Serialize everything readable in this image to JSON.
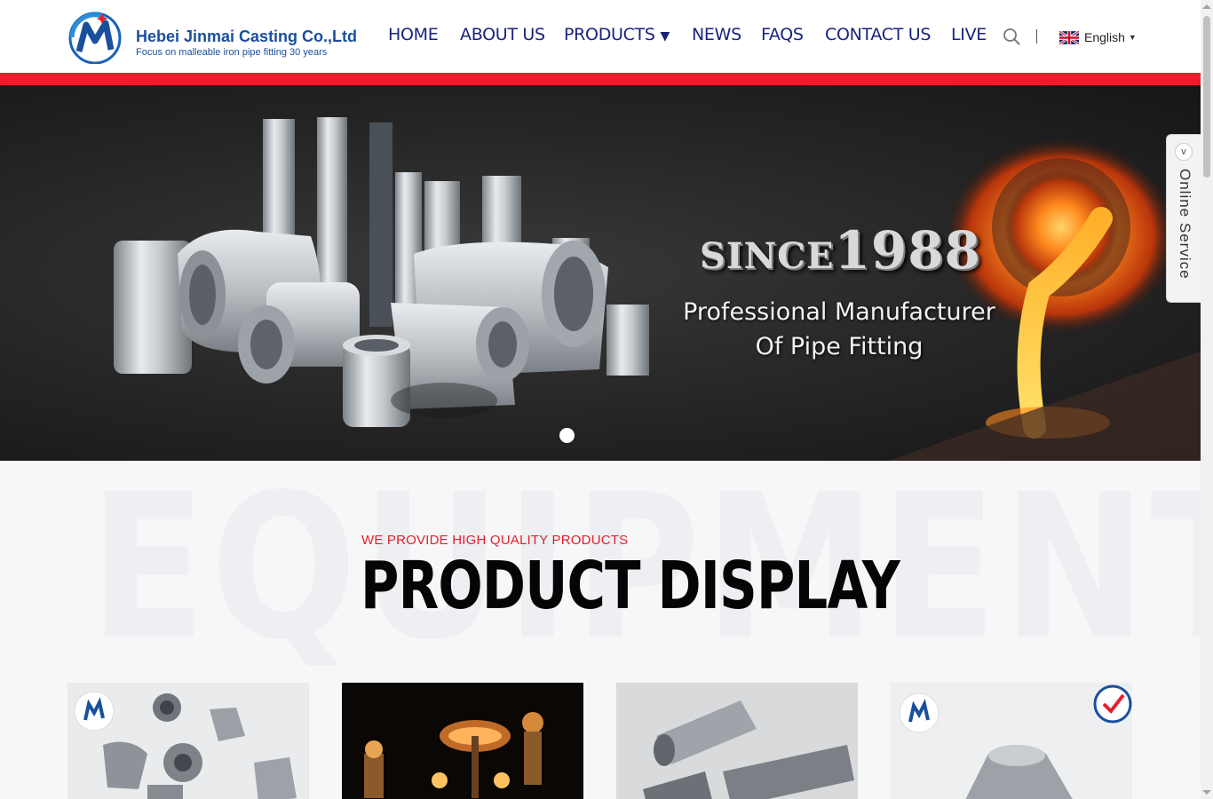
{
  "header": {
    "brand_name": "Hebei Jinmai Casting Co.,Ltd",
    "brand_tagline": "Focus on malleable iron pipe fitting 30 years",
    "nav": [
      "HOME",
      "ABOUT US",
      "PRODUCTS",
      "NEWS",
      "FAQS",
      "CONTACT US",
      "LIVE"
    ],
    "language": "English",
    "colors": {
      "brand_blue": "#1a4f9c",
      "nav": "#1a237e",
      "accent_red": "#e4202d"
    }
  },
  "banner": {
    "since_prefix": "SINCE",
    "since_year": "1988",
    "headline_line1": "Professional Manufacturer",
    "headline_line2": "Of Pipe Fitting",
    "slide_count": 1,
    "active_slide": 1
  },
  "online_service": {
    "label": "Online Service",
    "toggle_icon": "chevron-down-icon"
  },
  "products_section": {
    "watermark": "EQUIPMENT",
    "subtitle": "WE PROVIDE HIGH QUALITY PRODUCTS",
    "title": "PRODUCT DISPLAY",
    "cards": [
      {
        "name": "malleable-fittings-assortment",
        "has_logo": true
      },
      {
        "name": "pipe-lamp-decor",
        "has_logo": false
      },
      {
        "name": "pipe-nipples",
        "has_logo": false
      },
      {
        "name": "reducing-coupling",
        "has_logo": true,
        "has_badge": true
      }
    ]
  }
}
